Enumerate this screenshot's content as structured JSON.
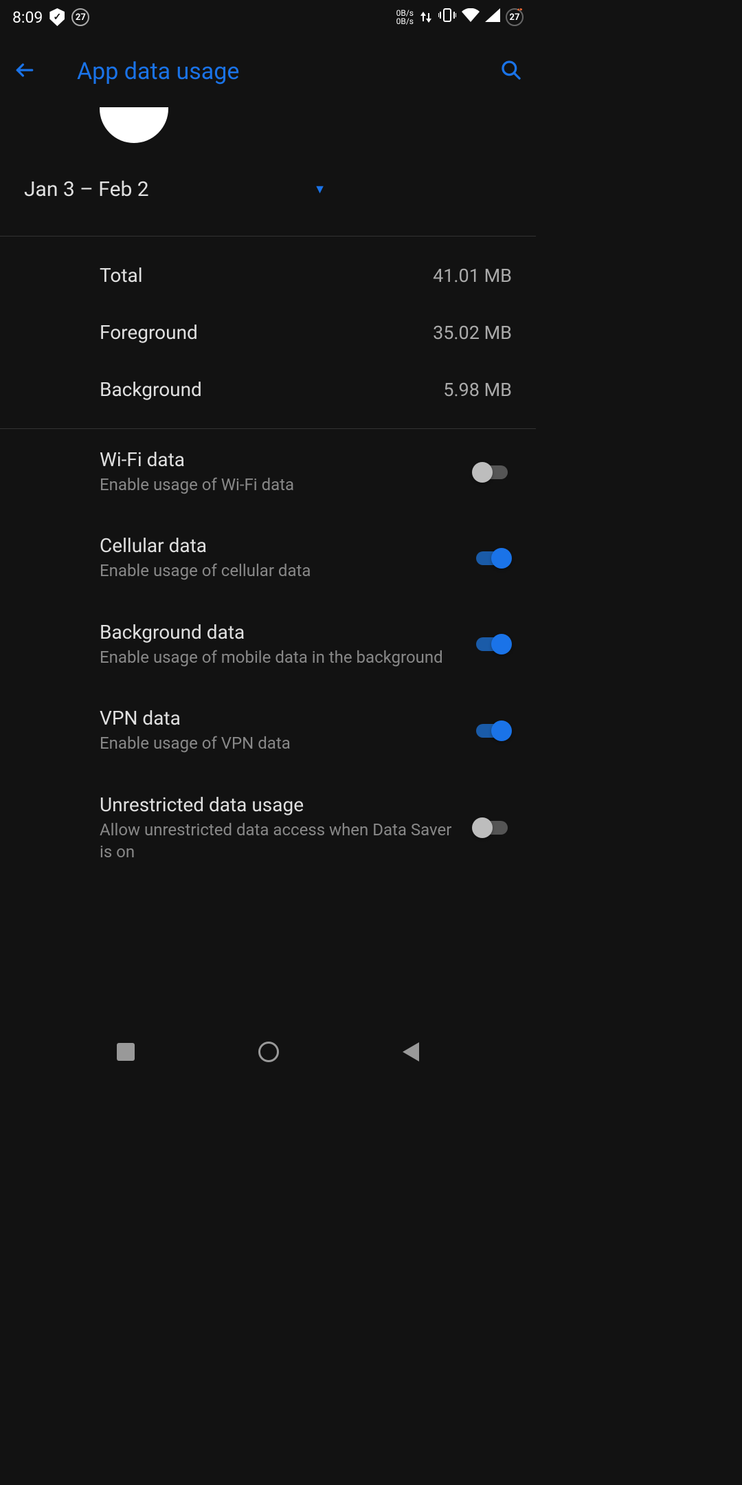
{
  "statusBar": {
    "time": "8:09",
    "badge_left": "27",
    "data_speed_up": "0B/s",
    "data_speed_down": "0B/s",
    "badge_right": "27"
  },
  "appBar": {
    "title": "App data usage"
  },
  "dateRange": {
    "text": "Jan 3 – Feb 2"
  },
  "stats": [
    {
      "label": "Total",
      "value": "41.01 MB"
    },
    {
      "label": "Foreground",
      "value": "35.02 MB"
    },
    {
      "label": "Background",
      "value": "5.98 MB"
    }
  ],
  "toggles": [
    {
      "title": "Wi-Fi data",
      "subtitle": "Enable usage of Wi-Fi data",
      "on": false
    },
    {
      "title": "Cellular data",
      "subtitle": "Enable usage of cellular data",
      "on": true
    },
    {
      "title": "Background data",
      "subtitle": "Enable usage of mobile data in the background",
      "on": true
    },
    {
      "title": "VPN data",
      "subtitle": "Enable usage of VPN data",
      "on": true
    },
    {
      "title": "Unrestricted data usage",
      "subtitle": "Allow unrestricted data access when Data Saver is on",
      "on": false
    }
  ]
}
